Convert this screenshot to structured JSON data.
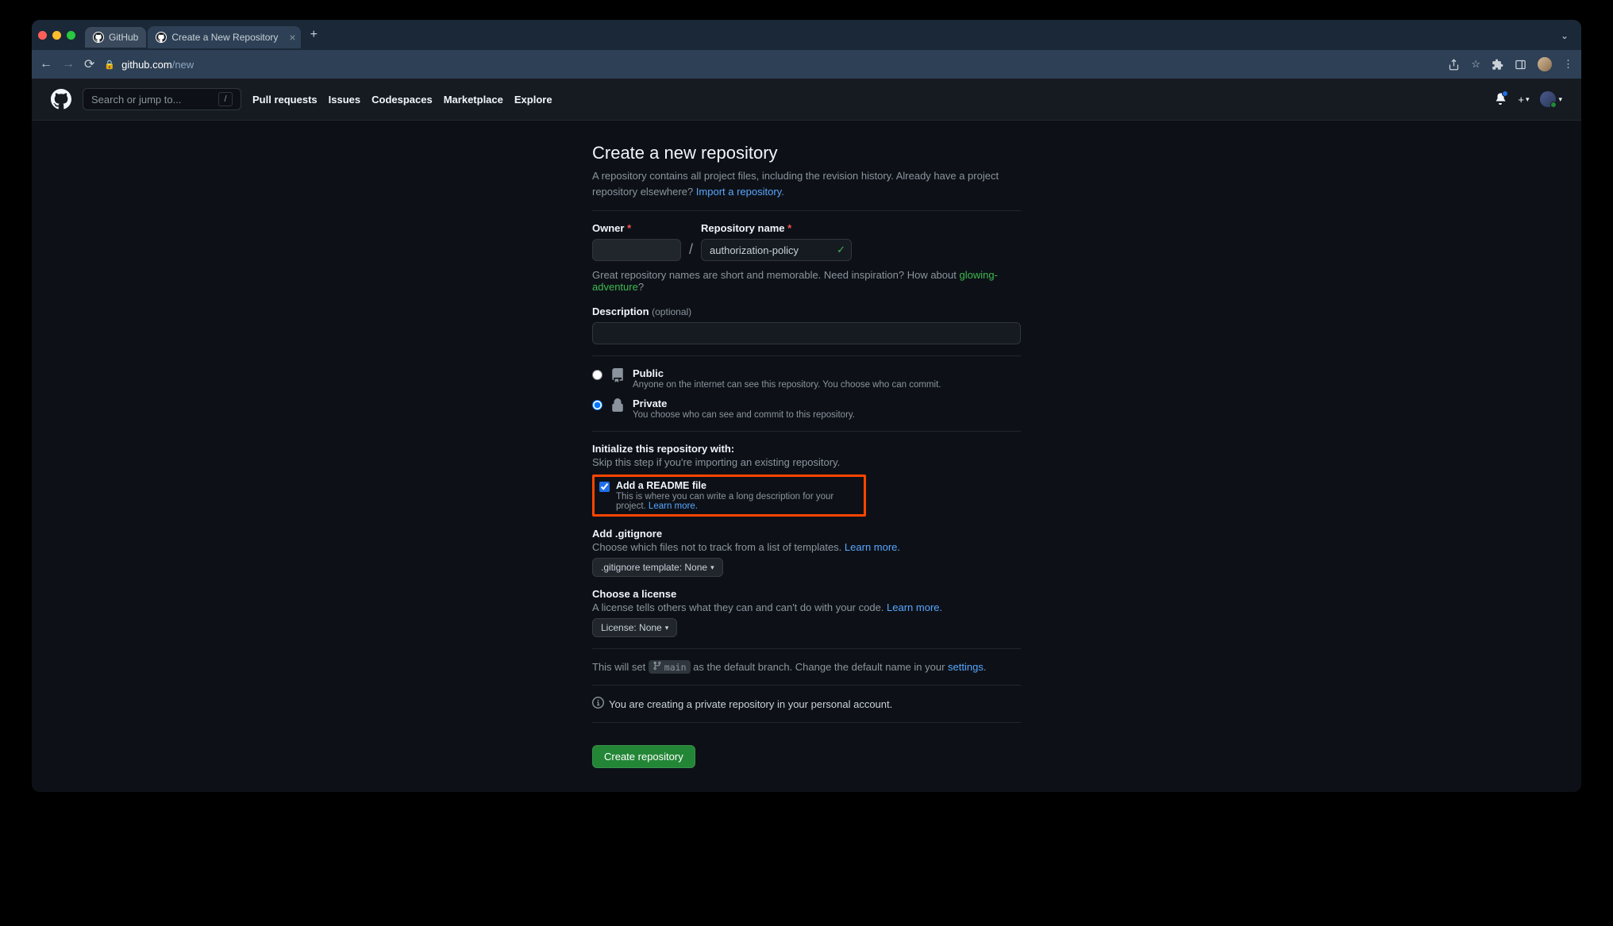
{
  "browser": {
    "tabs": [
      {
        "label": "GitHub"
      },
      {
        "label": "Create a New Repository"
      }
    ],
    "url_host": "github.com",
    "url_path": "/new"
  },
  "header": {
    "search_placeholder": "Search or jump to...",
    "nav": [
      "Pull requests",
      "Issues",
      "Codespaces",
      "Marketplace",
      "Explore"
    ]
  },
  "page": {
    "title": "Create a new repository",
    "subtitle_pre": "A repository contains all project files, including the revision history. Already have a project repository elsewhere? ",
    "import_link": "Import a repository",
    "owner_label": "Owner",
    "repo_label": "Repository name",
    "repo_name_value": "authorization-policy",
    "hint_pre": "Great repository names are short and memorable. Need inspiration? How about ",
    "hint_suggest": "glowing-adventure",
    "hint_q": "?",
    "desc_label": "Description",
    "desc_optional": "(optional)",
    "public_title": "Public",
    "public_desc": "Anyone on the internet can see this repository. You choose who can commit.",
    "private_title": "Private",
    "private_desc": "You choose who can see and commit to this repository.",
    "init_title": "Initialize this repository with:",
    "init_sub": "Skip this step if you're importing an existing repository.",
    "readme_title": "Add a README file",
    "readme_desc_pre": "This is where you can write a long description for your project. ",
    "learn_more": "Learn more.",
    "gitignore_title": "Add .gitignore",
    "gitignore_desc_pre": "Choose which files not to track from a list of templates. ",
    "gitignore_btn": ".gitignore template: None",
    "license_title": "Choose a license",
    "license_desc_pre": "A license tells others what they can and can't do with your code. ",
    "license_btn": "License: None",
    "branch_pre": "This will set ",
    "branch_name": "main",
    "branch_mid": " as the default branch. Change the default name in your ",
    "settings_link": "settings",
    "info_text": "You are creating a private repository in your personal account.",
    "submit": "Create repository"
  }
}
